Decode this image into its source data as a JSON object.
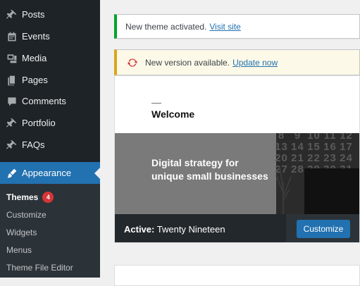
{
  "sidebar": {
    "items": [
      {
        "label": "Posts",
        "icon": "pin-icon"
      },
      {
        "label": "Events",
        "icon": "calendar-icon"
      },
      {
        "label": "Media",
        "icon": "media-icon"
      },
      {
        "label": "Pages",
        "icon": "page-icon"
      },
      {
        "label": "Comments",
        "icon": "comment-icon"
      },
      {
        "label": "Portfolio",
        "icon": "pin-icon"
      },
      {
        "label": "FAQs",
        "icon": "pin-icon"
      },
      {
        "label": "Appearance",
        "icon": "brush-icon"
      }
    ],
    "submenu": [
      {
        "label": "Themes",
        "badge": "4"
      },
      {
        "label": "Customize"
      },
      {
        "label": "Widgets"
      },
      {
        "label": "Menus"
      },
      {
        "label": "Theme File Editor"
      }
    ]
  },
  "notices": {
    "success": {
      "text": "New theme activated.",
      "link": "Visit site"
    },
    "update": {
      "text": "New version available.",
      "link": "Update now"
    }
  },
  "theme": {
    "preview": {
      "welcome": "Welcome",
      "hero_line1": "Digital strategy for",
      "hero_line2": "unique small businesses",
      "calendar_rows": [
        [
          "8",
          "9",
          "10",
          "11",
          "12"
        ],
        [
          "13",
          "14",
          "15",
          "16",
          "17"
        ],
        [
          "20",
          "21",
          "22",
          "23",
          "24"
        ],
        [
          "27",
          "28",
          "29",
          "30",
          "31"
        ]
      ]
    },
    "active_label": "Active:",
    "name": "Twenty Nineteen",
    "customize_label": "Customize"
  },
  "colors": {
    "sidebar_bg": "#1d2327",
    "accent": "#2271b1",
    "success": "#00a32a",
    "warning": "#dba617",
    "badge": "#d63638"
  }
}
